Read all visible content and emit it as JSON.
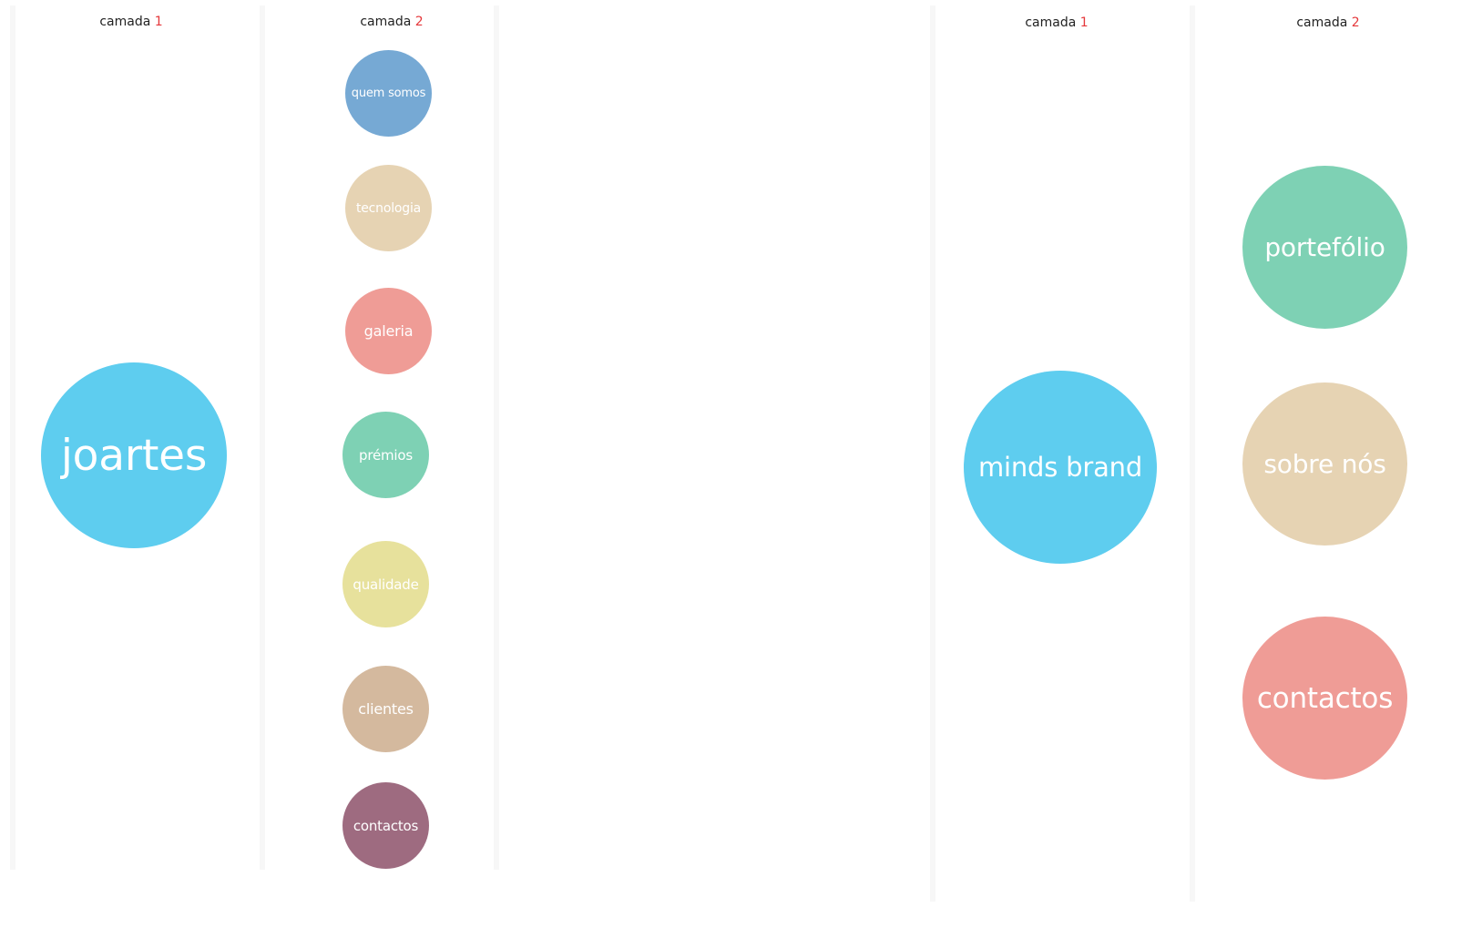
{
  "colors": {
    "cyan": "#5ecdef",
    "blue": "#76a9d4",
    "beige": "#e6d3b3",
    "salmon": "#ef9c96",
    "mint": "#7ed1b4",
    "yellow": "#e7e19c",
    "tan": "#d4b99e",
    "plum": "#9e6b80",
    "label_number": "#e5383b"
  },
  "left_diagram": {
    "layer1": {
      "label_word": "camada",
      "label_number": "1",
      "root_node": "joartes"
    },
    "layer2": {
      "label_word": "camada",
      "label_number": "2",
      "nodes": [
        "quem somos",
        "tecnologia",
        "galeria",
        "prémios",
        "qualidade",
        "clientes",
        "contactos"
      ]
    }
  },
  "right_diagram": {
    "layer1": {
      "label_word": "camada",
      "label_number": "1",
      "root_node": "minds brand"
    },
    "layer2": {
      "label_word": "camada",
      "label_number": "2",
      "nodes": [
        "portefólio",
        "sobre nós",
        "contactos"
      ]
    }
  }
}
